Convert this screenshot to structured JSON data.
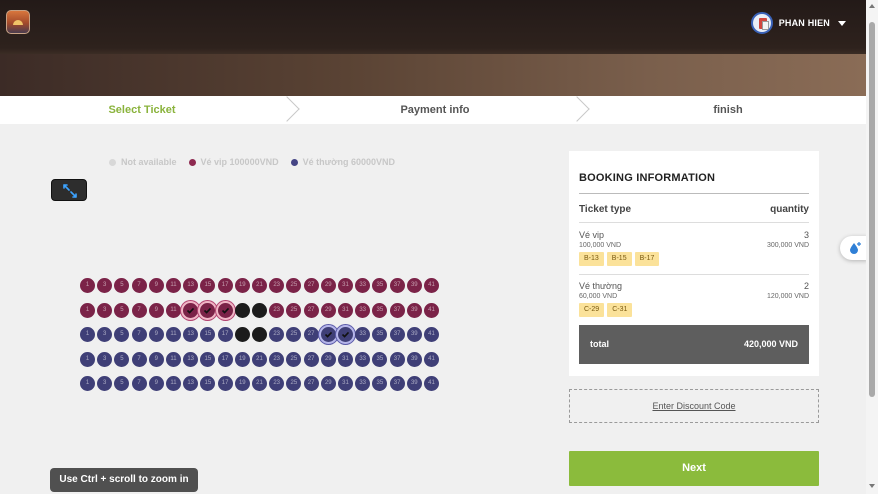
{
  "header": {
    "user_name": "PHAN HIEN"
  },
  "steps": [
    {
      "label": "Select Ticket",
      "active": true
    },
    {
      "label": "Payment info",
      "active": false
    },
    {
      "label": "finish",
      "active": false
    }
  ],
  "legend": [
    {
      "label": "Not available",
      "color": "#d8d8d8"
    },
    {
      "label": "Vé vip 100000VND",
      "color": "#8e2a50"
    },
    {
      "label": "Vé thường 60000VND",
      "color": "#454585"
    }
  ],
  "seat_rows": [
    {
      "row": "A",
      "type": "vip",
      "seats": [
        1,
        3,
        5,
        7,
        9,
        11,
        13,
        15,
        17,
        19,
        21,
        23,
        25,
        27,
        29,
        31,
        33,
        35,
        37,
        39,
        41
      ],
      "unavailable": [],
      "selected": []
    },
    {
      "row": "B",
      "type": "vip",
      "seats": [
        1,
        3,
        5,
        7,
        9,
        11,
        13,
        15,
        17,
        19,
        21,
        23,
        25,
        27,
        29,
        31,
        33,
        35,
        37,
        39,
        41
      ],
      "unavailable": [
        19,
        21
      ],
      "selected": [
        13,
        15,
        17
      ]
    },
    {
      "row": "C",
      "type": "normal",
      "seats": [
        1,
        3,
        5,
        7,
        9,
        11,
        13,
        15,
        17,
        19,
        21,
        23,
        25,
        27,
        29,
        31,
        33,
        35,
        37,
        39,
        41
      ],
      "unavailable": [
        19,
        21
      ],
      "selected": [
        29,
        31
      ]
    },
    {
      "row": "D",
      "type": "normal",
      "seats": [
        1,
        3,
        5,
        7,
        9,
        11,
        13,
        15,
        17,
        19,
        21,
        23,
        25,
        27,
        29,
        31,
        33,
        35,
        37,
        39,
        41
      ],
      "unavailable": [],
      "selected": []
    },
    {
      "row": "E",
      "type": "normal",
      "seats": [
        1,
        3,
        5,
        7,
        9,
        11,
        13,
        15,
        17,
        19,
        21,
        23,
        25,
        27,
        29,
        31,
        33,
        35,
        37,
        39,
        41
      ],
      "unavailable": [],
      "selected": []
    }
  ],
  "zoom_hint": "Use Ctrl + scroll to zoom in",
  "booking": {
    "title": "BOOKING INFORMATION",
    "col_type": "Ticket type",
    "col_qty": "quantity",
    "vip": {
      "name": "Vé vip",
      "price": "100,000 VND",
      "qty": "3",
      "subtotal": "300,000 VND",
      "seats": [
        "B-13",
        "B-15",
        "B-17"
      ]
    },
    "normal": {
      "name": "Vé thường",
      "price": "60,000 VND",
      "qty": "2",
      "subtotal": "120,000 VND",
      "seats": [
        "C-29",
        "C-31"
      ]
    },
    "total_label": "total",
    "total_value": "420,000 VND"
  },
  "discount_label": "Enter Discount Code",
  "next_label": "Next",
  "colors": {
    "accent": "#8bbb3c",
    "vip": "#7b2348",
    "normal": "#3f3f77",
    "unavailable": "#1c1c1c"
  }
}
